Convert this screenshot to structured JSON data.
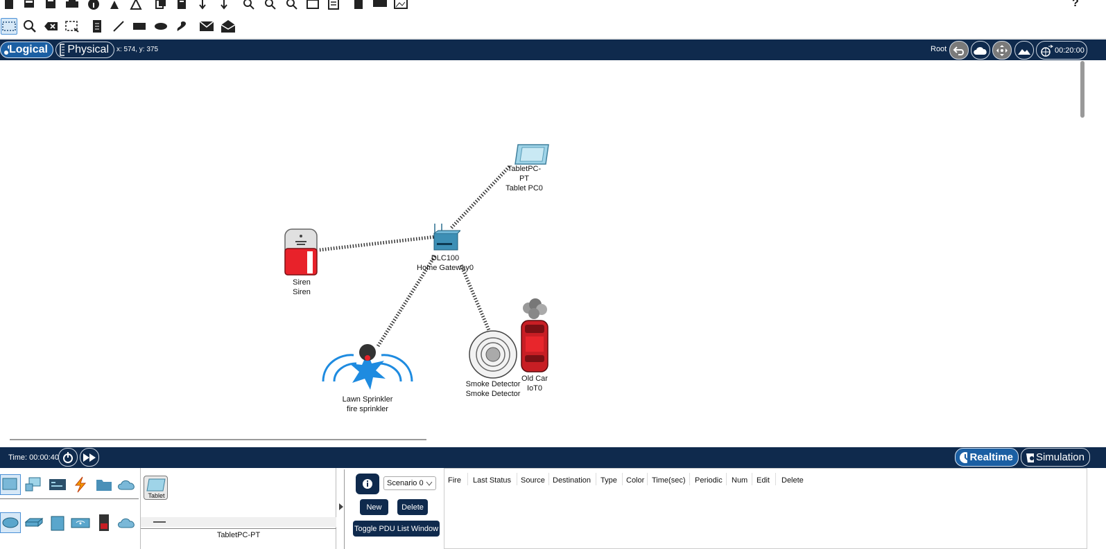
{
  "toolbar": {
    "help_label": "?"
  },
  "nav": {
    "logical_label": "Logical",
    "physical_label": "Physical",
    "coords": "x: 574, y: 375",
    "root_label": "Root",
    "clock": "00:20:00"
  },
  "devices": {
    "tablet": {
      "model": "TabletPC-PT",
      "name": "Tablet PC0"
    },
    "gateway": {
      "model": "DLC100",
      "name": "Home Gateway0"
    },
    "siren": {
      "model": "Siren",
      "name": "Siren"
    },
    "sprinkler": {
      "model": "Lawn Sprinkler",
      "name": "fire sprinkler"
    },
    "smoke": {
      "model": "Smoke Detector",
      "name": "Smoke Detector"
    },
    "car": {
      "model": "Old Car",
      "name": "IoT0"
    }
  },
  "timebar": {
    "time": "Time: 00:00:40",
    "realtime_label": "Realtime",
    "simulation_label": "Simulation"
  },
  "device_panel": {
    "selected_device_label": "Tablet",
    "selected_model_caption": "TabletPC-PT"
  },
  "scenario": {
    "selected": "Scenario 0",
    "new_label": "New",
    "delete_label": "Delete",
    "toggle_label": "Toggle PDU List Window"
  },
  "pdu_table": {
    "columns": [
      "Fire",
      "Last Status",
      "Source",
      "Destination",
      "Type",
      "Color",
      "Time(sec)",
      "Periodic",
      "Num",
      "Edit",
      "Delete"
    ]
  },
  "colors": {
    "navy": "#0f2a4d",
    "accent_blue": "#1b5fa3",
    "siren_red": "#e8222a",
    "sprinkler_blue": "#1e8be0"
  }
}
